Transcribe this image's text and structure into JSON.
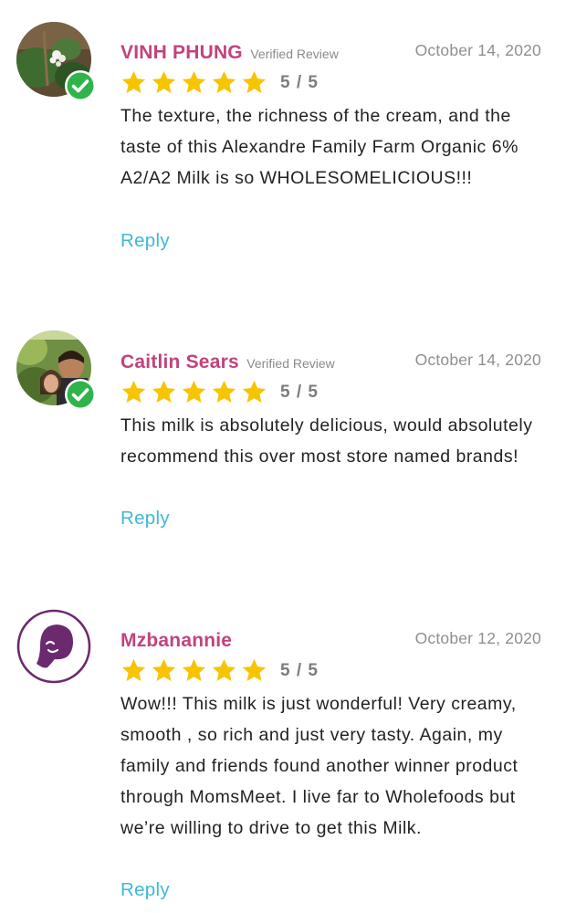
{
  "reviews": [
    {
      "name": "VINH PHUNG",
      "verified_label": "Verified Review",
      "date": "October 14, 2020",
      "rating_text": "5 / 5",
      "rating": 5,
      "text": "The texture, the richness of the cream, and the taste of this Alexandre Family Farm Organic 6% A2/A2 Milk is so WHOLESOMELICIOUS!!!",
      "reply_label": "Reply",
      "avatar_icon": "user-photo",
      "verified": true
    },
    {
      "name": "Caitlin Sears",
      "verified_label": "Verified Review",
      "date": "October 14, 2020",
      "rating_text": "5 / 5",
      "rating": 5,
      "text": "This milk is absolutely delicious, would absolutely recommend this over most store named brands!",
      "reply_label": "Reply",
      "avatar_icon": "user-photo",
      "verified": true
    },
    {
      "name": "Mzbanannie",
      "date": "October 12, 2020",
      "rating_text": "5 / 5",
      "rating": 5,
      "text": "Wow!!! This milk is just wonderful! Very creamy, smooth , so rich and just very tasty. Again, my family and friends found another winner product through MomsMeet. I live far to Wholefoods but we’re willing to drive to get this Milk.",
      "reply_label": "Reply",
      "avatar_icon": "default-avatar-icon",
      "verified": false
    }
  ],
  "colors": {
    "name": "#c2437c",
    "star": "#f7c400",
    "reply": "#3fb8d6",
    "verified_badge": "#2fb44b",
    "default_avatar": "#6b2a6e"
  }
}
